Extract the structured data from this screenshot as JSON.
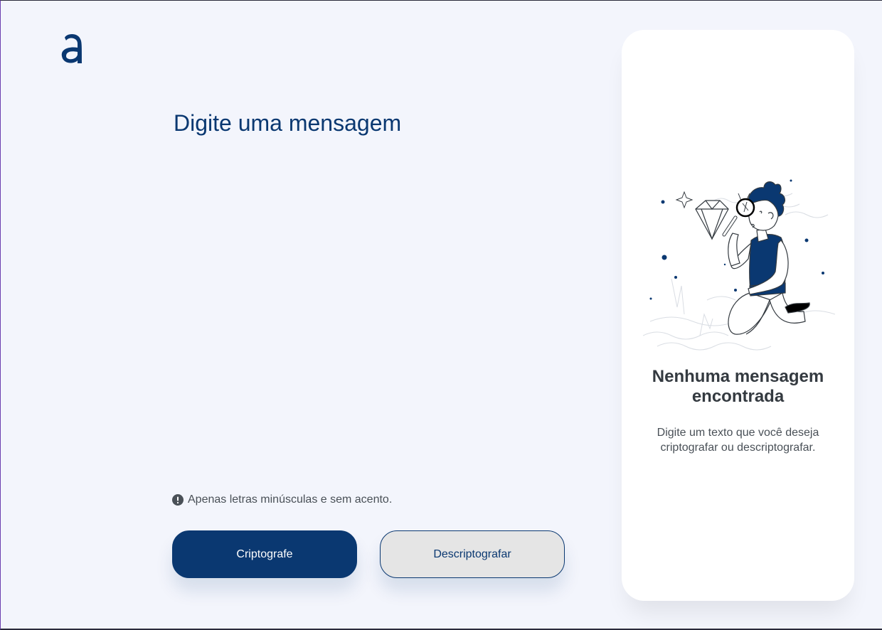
{
  "logo": {
    "icon": "alura-a-logo",
    "color": "#0a3871"
  },
  "input": {
    "placeholder": "Digite uma mensagem",
    "value": ""
  },
  "hint": {
    "icon": "exclamation-circle-icon",
    "text": "Apenas letras minúsculas e sem acento."
  },
  "buttons": {
    "encrypt_label": "Criptografe",
    "decrypt_label": "Descriptografar"
  },
  "output_panel": {
    "illustration": "person-with-magnifying-glass-illustration",
    "title": "Nenhuma mensagem encontrada",
    "description": "Digite um texto que você deseja criptografar ou descriptografar."
  },
  "colors": {
    "primary": "#0a3871",
    "background": "#f3f5fc",
    "panel": "#ffffff",
    "secondary_button": "#e5e5e5"
  }
}
